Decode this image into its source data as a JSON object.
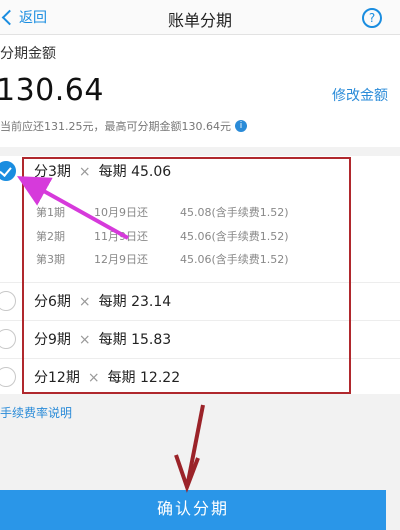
{
  "navbar": {
    "back_label": "返回",
    "title": "账单分期",
    "help_glyph": "?"
  },
  "amount": {
    "label": "分期金额",
    "value": "130.64",
    "modify_label": "修改金额",
    "note": "当前应还131.25元，最高可分期金额130.64元",
    "info_glyph": "i"
  },
  "plans": [
    {
      "count": "分3期",
      "times": "×",
      "per_label": "每期",
      "per_amount": "45.06",
      "selected": true
    },
    {
      "count": "分6期",
      "times": "×",
      "per_label": "每期",
      "per_amount": "23.14",
      "selected": false
    },
    {
      "count": "分9期",
      "times": "×",
      "per_label": "每期",
      "per_amount": "15.83",
      "selected": false
    },
    {
      "count": "分12期",
      "times": "×",
      "per_label": "每期",
      "per_amount": "12.22",
      "selected": false
    }
  ],
  "schedule": [
    {
      "period": "第1期",
      "date": "10月9日还",
      "amount": "45.08(含手续费1.52)"
    },
    {
      "period": "第2期",
      "date": "11月9日还",
      "amount": "45.06(含手续费1.52)"
    },
    {
      "period": "第3期",
      "date": "12月9日还",
      "amount": "45.06(含手续费1.52)"
    }
  ],
  "fee_link": "手续费率说明",
  "confirm_button": "确认分期",
  "colors": {
    "accent": "#2a96e8",
    "annotation_box": "#b0282d",
    "annotation_arrow": "#d63adb"
  }
}
